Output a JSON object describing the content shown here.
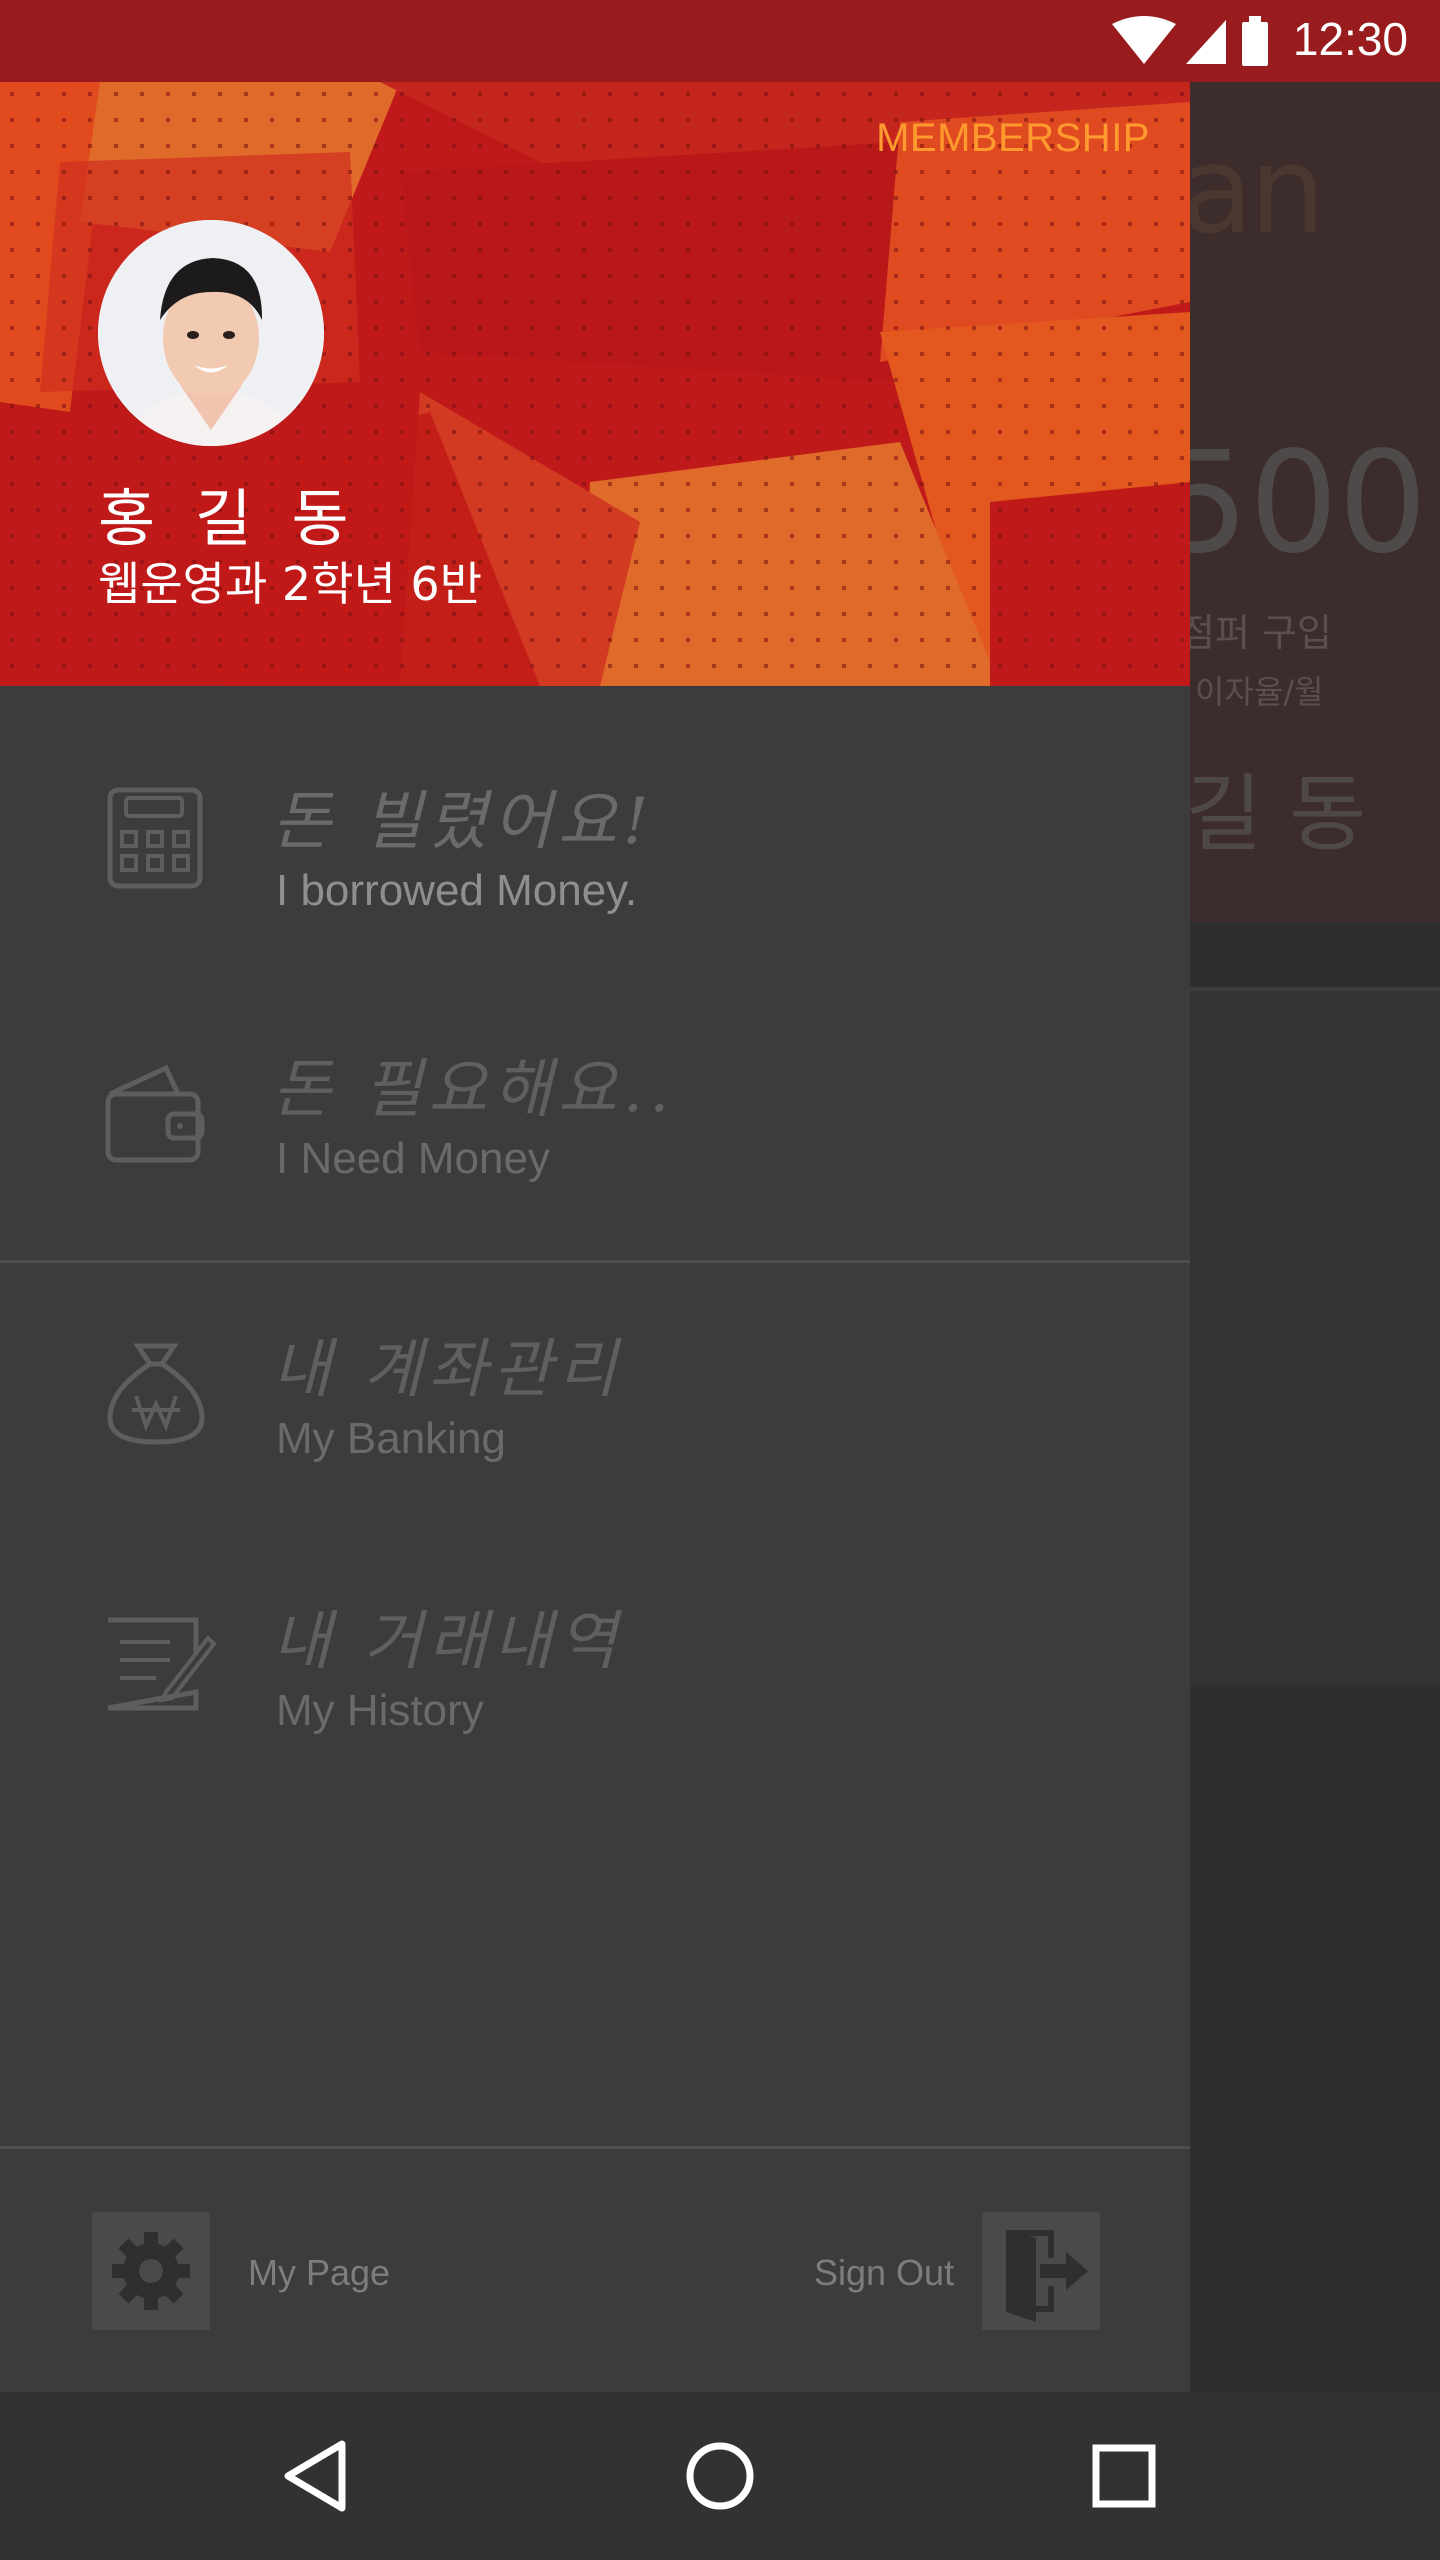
{
  "status_bar": {
    "time": "12:30",
    "icons": [
      "wifi-icon",
      "signal-icon",
      "battery-icon"
    ]
  },
  "background_app": {
    "logo_text": "an",
    "amount_text": "500",
    "subtitle_1": "점퍼 구입",
    "subtitle_2": "이자율/월",
    "name_fragment": "길 동"
  },
  "drawer": {
    "header": {
      "membership_label": "MEMBERSHIP",
      "user_name": "홍 길 동",
      "user_class": "웹운영과 2학년 6반",
      "colors": {
        "primary": "#c0191a",
        "accent": "#ff9a2e"
      }
    },
    "menu_items": [
      {
        "icon": "calculator-icon",
        "title": "돈 빌렸어요!",
        "subtitle": "I borrowed Money."
      },
      {
        "icon": "wallet-icon",
        "title": "돈 필요해요..",
        "subtitle": "I Need Money"
      },
      {
        "icon": "money-bag-icon",
        "title": "내 계좌관리",
        "subtitle": "My Banking"
      },
      {
        "icon": "notepad-icon",
        "title": "내 거래내역",
        "subtitle": "My History"
      }
    ],
    "footer": {
      "my_page_label": "My Page",
      "sign_out_label": "Sign Out"
    }
  },
  "nav_bar": {
    "buttons": [
      "back-icon",
      "home-icon",
      "recents-icon"
    ]
  }
}
